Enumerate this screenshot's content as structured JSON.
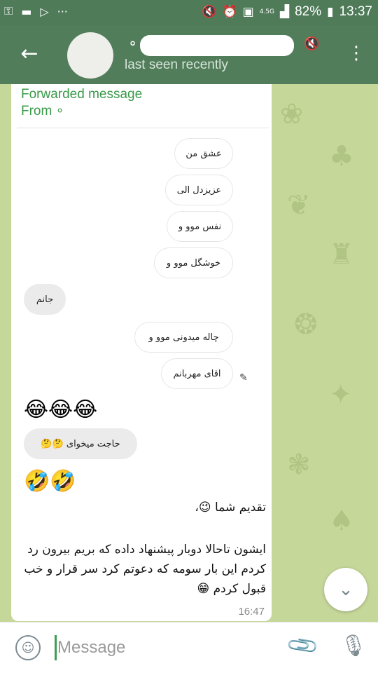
{
  "status_bar": {
    "left_icons": [
      "key-icon",
      "chat-icon",
      "play-icon",
      "more-dots-icon"
    ],
    "network_badge": "4.5G",
    "battery": "82%",
    "time": "13:37"
  },
  "header": {
    "back": "←",
    "contact_initial": "∘",
    "status": "last seen recently",
    "mute_icon": "🔇",
    "menu": "⋮"
  },
  "message": {
    "forwarded_label": "Forwarded message",
    "from_label": "From ∘",
    "screenshot": {
      "bubbles": [
        {
          "text": "عشق من"
        },
        {
          "text": "عزیزدل الی"
        },
        {
          "text": "نفس موو و"
        },
        {
          "text": "خوشگل موو و"
        },
        {
          "text": "جانم"
        },
        {
          "text": "چاله میدونی موو و"
        },
        {
          "text": "اقای مهربانم"
        }
      ],
      "emoji_row_1": "😂😂😂",
      "question": "حاجت میخوای 🤔🤔",
      "emoji_row_2": "🤣🤣"
    },
    "caption_1": "تقدیم شما 😉،",
    "caption_2": "ایشون تاحالا دوبار پیشنهاد داده که بریم بیرون رد کردم این بار سومه که دعوتم کرد سر قرار و خب قبول کردم 😁",
    "time": "16:47"
  },
  "scroll_down": "⌄",
  "input": {
    "placeholder": "Message",
    "emoji": "☺",
    "attach": "📎",
    "mic": "🎙"
  }
}
